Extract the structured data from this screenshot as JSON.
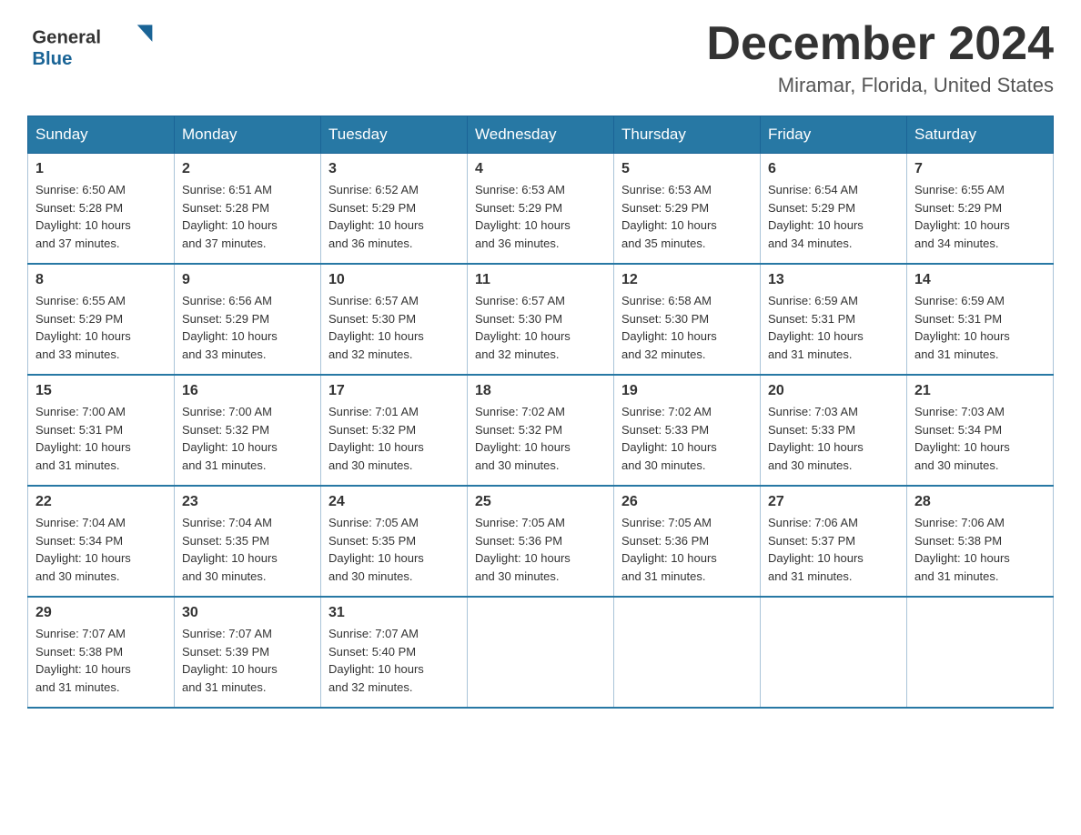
{
  "logo": {
    "general": "General",
    "blue": "Blue"
  },
  "title": {
    "month_year": "December 2024",
    "location": "Miramar, Florida, United States"
  },
  "weekdays": [
    "Sunday",
    "Monday",
    "Tuesday",
    "Wednesday",
    "Thursday",
    "Friday",
    "Saturday"
  ],
  "weeks": [
    [
      {
        "day": "1",
        "sunrise": "6:50 AM",
        "sunset": "5:28 PM",
        "daylight": "10 hours and 37 minutes."
      },
      {
        "day": "2",
        "sunrise": "6:51 AM",
        "sunset": "5:28 PM",
        "daylight": "10 hours and 37 minutes."
      },
      {
        "day": "3",
        "sunrise": "6:52 AM",
        "sunset": "5:29 PM",
        "daylight": "10 hours and 36 minutes."
      },
      {
        "day": "4",
        "sunrise": "6:53 AM",
        "sunset": "5:29 PM",
        "daylight": "10 hours and 36 minutes."
      },
      {
        "day": "5",
        "sunrise": "6:53 AM",
        "sunset": "5:29 PM",
        "daylight": "10 hours and 35 minutes."
      },
      {
        "day": "6",
        "sunrise": "6:54 AM",
        "sunset": "5:29 PM",
        "daylight": "10 hours and 34 minutes."
      },
      {
        "day": "7",
        "sunrise": "6:55 AM",
        "sunset": "5:29 PM",
        "daylight": "10 hours and 34 minutes."
      }
    ],
    [
      {
        "day": "8",
        "sunrise": "6:55 AM",
        "sunset": "5:29 PM",
        "daylight": "10 hours and 33 minutes."
      },
      {
        "day": "9",
        "sunrise": "6:56 AM",
        "sunset": "5:29 PM",
        "daylight": "10 hours and 33 minutes."
      },
      {
        "day": "10",
        "sunrise": "6:57 AM",
        "sunset": "5:30 PM",
        "daylight": "10 hours and 32 minutes."
      },
      {
        "day": "11",
        "sunrise": "6:57 AM",
        "sunset": "5:30 PM",
        "daylight": "10 hours and 32 minutes."
      },
      {
        "day": "12",
        "sunrise": "6:58 AM",
        "sunset": "5:30 PM",
        "daylight": "10 hours and 32 minutes."
      },
      {
        "day": "13",
        "sunrise": "6:59 AM",
        "sunset": "5:31 PM",
        "daylight": "10 hours and 31 minutes."
      },
      {
        "day": "14",
        "sunrise": "6:59 AM",
        "sunset": "5:31 PM",
        "daylight": "10 hours and 31 minutes."
      }
    ],
    [
      {
        "day": "15",
        "sunrise": "7:00 AM",
        "sunset": "5:31 PM",
        "daylight": "10 hours and 31 minutes."
      },
      {
        "day": "16",
        "sunrise": "7:00 AM",
        "sunset": "5:32 PM",
        "daylight": "10 hours and 31 minutes."
      },
      {
        "day": "17",
        "sunrise": "7:01 AM",
        "sunset": "5:32 PM",
        "daylight": "10 hours and 30 minutes."
      },
      {
        "day": "18",
        "sunrise": "7:02 AM",
        "sunset": "5:32 PM",
        "daylight": "10 hours and 30 minutes."
      },
      {
        "day": "19",
        "sunrise": "7:02 AM",
        "sunset": "5:33 PM",
        "daylight": "10 hours and 30 minutes."
      },
      {
        "day": "20",
        "sunrise": "7:03 AM",
        "sunset": "5:33 PM",
        "daylight": "10 hours and 30 minutes."
      },
      {
        "day": "21",
        "sunrise": "7:03 AM",
        "sunset": "5:34 PM",
        "daylight": "10 hours and 30 minutes."
      }
    ],
    [
      {
        "day": "22",
        "sunrise": "7:04 AM",
        "sunset": "5:34 PM",
        "daylight": "10 hours and 30 minutes."
      },
      {
        "day": "23",
        "sunrise": "7:04 AM",
        "sunset": "5:35 PM",
        "daylight": "10 hours and 30 minutes."
      },
      {
        "day": "24",
        "sunrise": "7:05 AM",
        "sunset": "5:35 PM",
        "daylight": "10 hours and 30 minutes."
      },
      {
        "day": "25",
        "sunrise": "7:05 AM",
        "sunset": "5:36 PM",
        "daylight": "10 hours and 30 minutes."
      },
      {
        "day": "26",
        "sunrise": "7:05 AM",
        "sunset": "5:36 PM",
        "daylight": "10 hours and 31 minutes."
      },
      {
        "day": "27",
        "sunrise": "7:06 AM",
        "sunset": "5:37 PM",
        "daylight": "10 hours and 31 minutes."
      },
      {
        "day": "28",
        "sunrise": "7:06 AM",
        "sunset": "5:38 PM",
        "daylight": "10 hours and 31 minutes."
      }
    ],
    [
      {
        "day": "29",
        "sunrise": "7:07 AM",
        "sunset": "5:38 PM",
        "daylight": "10 hours and 31 minutes."
      },
      {
        "day": "30",
        "sunrise": "7:07 AM",
        "sunset": "5:39 PM",
        "daylight": "10 hours and 31 minutes."
      },
      {
        "day": "31",
        "sunrise": "7:07 AM",
        "sunset": "5:40 PM",
        "daylight": "10 hours and 32 minutes."
      },
      null,
      null,
      null,
      null
    ]
  ],
  "labels": {
    "sunrise": "Sunrise:",
    "sunset": "Sunset:",
    "daylight": "Daylight:"
  }
}
